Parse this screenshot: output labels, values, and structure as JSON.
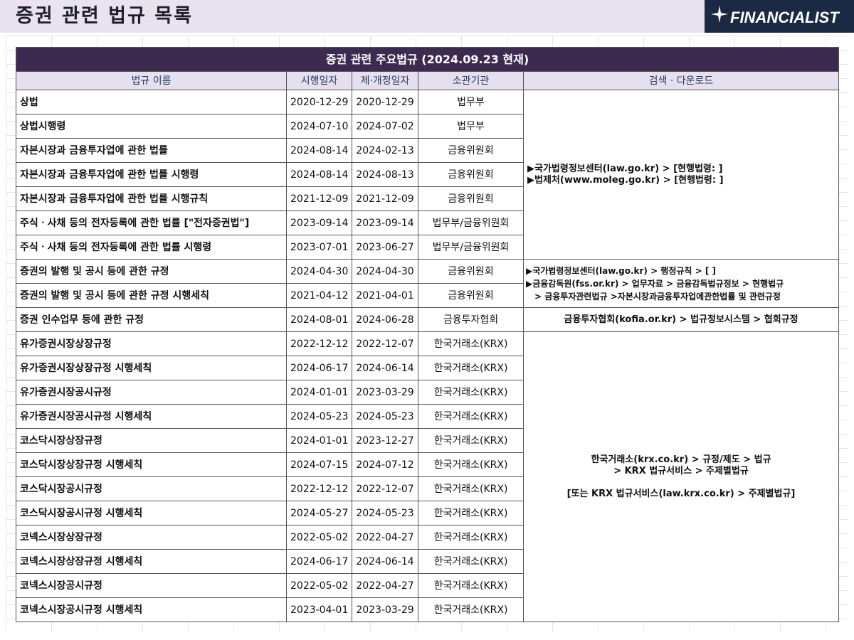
{
  "page_title": "증권 관련 법규 목록",
  "logo": {
    "text": "FINANCIALIST",
    "icon": "sparkle-star-icon"
  },
  "colors": {
    "banner": "#3d2a50",
    "header_row": "#e6e0ee",
    "logo_bg": "#1b2a44",
    "title_bar": "#e9e3ef"
  },
  "table": {
    "banner": "증권 관련 주요법규 (2024.09.23 현재)",
    "headers": [
      "법규 이름",
      "시행일자",
      "제·개정일자",
      "소관기관",
      "검색 · 다운로드"
    ],
    "rows": [
      [
        "상법",
        "2020-12-29",
        "2020-12-29",
        "법무부"
      ],
      [
        "상법시행령",
        "2024-07-10",
        "2024-07-02",
        "법무부"
      ],
      [
        "자본시장과 금융투자업에 관한 법률",
        "2024-08-14",
        "2024-02-13",
        "금융위원회"
      ],
      [
        "자본시장과 금융투자업에 관한 법률 시행령",
        "2024-08-14",
        "2024-08-13",
        "금융위원회"
      ],
      [
        "자본시장과 금융투자업에 관한 법률 시행규칙",
        "2021-12-09",
        "2021-12-09",
        "금융위원회"
      ],
      [
        "주식ㆍ사채 등의 전자등록에 관한 법률 [\"전자증권법\"]",
        "2023-09-14",
        "2023-09-14",
        "법무부/금융위원회"
      ],
      [
        "주식ㆍ사채 등의 전자등록에 관한 법률 시행령",
        "2023-07-01",
        "2023-06-27",
        "법무부/금융위원회"
      ],
      [
        "증권의 발행 및 공시 등에 관한 규정",
        "2024-04-30",
        "2024-04-30",
        "금융위원회"
      ],
      [
        "증권의 발행 및 공시 등에 관한 규정 시행세칙",
        "2021-04-12",
        "2021-04-01",
        "금융위원회"
      ],
      [
        "증권 인수업무 등에 관한 규정",
        "2024-08-01",
        "2024-06-28",
        "금융투자협회"
      ],
      [
        "유가증권시장상장규정",
        "2022-12-12",
        "2022-12-07",
        "한국거래소(KRX)"
      ],
      [
        "유가증권시장상장규정 시행세칙",
        "2024-06-17",
        "2024-06-14",
        "한국거래소(KRX)"
      ],
      [
        "유가증권시장공시규정",
        "2024-01-01",
        "2023-03-29",
        "한국거래소(KRX)"
      ],
      [
        "유가증권시장공시규정 시행세칙",
        "2024-05-23",
        "2024-05-23",
        "한국거래소(KRX)"
      ],
      [
        "코스닥시장상장규정",
        "2024-01-01",
        "2023-12-27",
        "한국거래소(KRX)"
      ],
      [
        "코스닥시장상장규정 시행세칙",
        "2024-07-15",
        "2024-07-12",
        "한국거래소(KRX)"
      ],
      [
        "코스닥시장공시규정",
        "2022-12-12",
        "2022-12-07",
        "한국거래소(KRX)"
      ],
      [
        "코스닥시장공시규정 시행세칙",
        "2024-05-27",
        "2024-05-23",
        "한국거래소(KRX)"
      ],
      [
        "코넥스시장상장규정",
        "2022-05-02",
        "2022-04-27",
        "한국거래소(KRX)"
      ],
      [
        "코넥스시장상장규정 시행세칙",
        "2024-06-17",
        "2024-06-14",
        "한국거래소(KRX)"
      ],
      [
        "코넥스시장공시규정",
        "2022-05-02",
        "2022-04-27",
        "한국거래소(KRX)"
      ],
      [
        "코넥스시장공시규정 시행세칙",
        "2023-04-01",
        "2023-03-29",
        "한국거래소(KRX)"
      ]
    ],
    "links": {
      "group1": [
        "▶국가법령정보센터(law.go.kr) > [현행법령: ]",
        "▶법제처(www.moleg.go.kr) > [현행법령: ]"
      ],
      "group2": [
        "▶국가법령정보센터(law.go.kr) > 행정규칙 > [ ]",
        "▶금융감독원(fss.or.kr) > 업무자료 > 금융감독법규정보 > 현행법규",
        "> 금융투자관련법규 >자본시장과금융투자업에관한법률 및 관련규정"
      ],
      "group3": [
        "금융투자협회(kofia.or.kr) > 법규정보시스템 > 협회규정"
      ],
      "group4": [
        "한국거래소(krx.co.kr) > 규정/제도 > 법규",
        "> KRX 법규서비스 > 주제별법규",
        "[또는 KRX 법규서비스(law.krx.co.kr) > 주제별법규]"
      ]
    }
  }
}
